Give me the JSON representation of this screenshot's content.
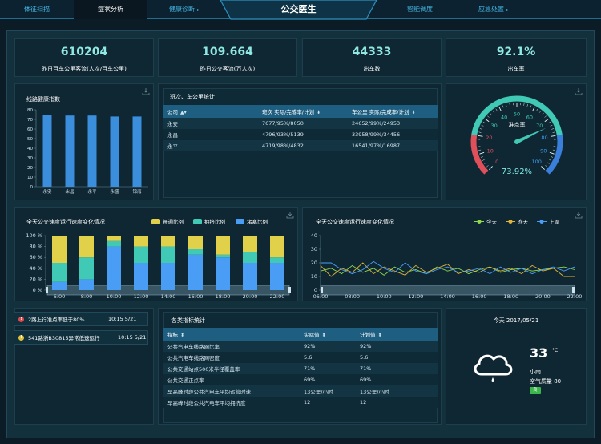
{
  "header": {
    "title": "公交医生",
    "tabs": [
      {
        "label": "体征扫描",
        "caret": ""
      },
      {
        "label": "症状分析",
        "caret": ""
      },
      {
        "label": "健康诊断",
        "caret": "▸"
      },
      {
        "label": "智能调度",
        "caret": ""
      },
      {
        "label": "应急处置",
        "caret": "▸"
      }
    ]
  },
  "stats": [
    {
      "value": "610204",
      "label": "昨日百车公里客流(人次/百车公里)"
    },
    {
      "value": "109.664",
      "label": "昨日公交客流(万人次)"
    },
    {
      "value": "44333",
      "label": "出车数"
    },
    {
      "value": "92.1%",
      "label": "出车率"
    }
  ],
  "health_chart": {
    "title": "线路健康指数",
    "chart_data": {
      "type": "bar",
      "categories": [
        "永安",
        "永昌",
        "永平",
        "永盛",
        "锦海"
      ],
      "values": [
        75,
        74,
        74,
        73,
        73
      ],
      "ylim": [
        0,
        80
      ],
      "yticks": [
        "0",
        "10",
        "20",
        "30",
        "40",
        "50",
        "60",
        "70",
        "80"
      ],
      "color": "#3a8edb"
    }
  },
  "shift_table": {
    "title": "班次、车公里统计",
    "headers": [
      "公司",
      "班次 实际/完成率/计划",
      "车公里 实际/完成率/计划"
    ],
    "rows": [
      [
        "永安",
        "7677/95%/8050",
        "24652/99%/24953"
      ],
      [
        "永昌",
        "4796/93%/5139",
        "33958/99%/34456"
      ],
      [
        "永平",
        "4719/98%/4832",
        "16541/97%/16987"
      ]
    ]
  },
  "gauge": {
    "label": "准点率",
    "value": "73.92%",
    "value_num": 73.92,
    "ticks": [
      "0",
      "10",
      "20",
      "30",
      "40",
      "50",
      "60",
      "70",
      "80",
      "90",
      "100"
    ]
  },
  "stacked_chart": {
    "title": "全天公交速度运行速度变化情况",
    "chart_data": {
      "type": "bar",
      "categories": [
        "6:00",
        "8:00",
        "10:00",
        "12:00",
        "14:00",
        "16:00",
        "18:00",
        "20:00",
        "22:00"
      ],
      "series": [
        {
          "name": "堵塞比例",
          "color": "#4a9df5",
          "values": [
            15,
            20,
            80,
            50,
            50,
            65,
            60,
            50,
            50
          ]
        },
        {
          "name": "拥挤比例",
          "color": "#40c9b5",
          "values": [
            35,
            40,
            10,
            30,
            30,
            10,
            5,
            20,
            10
          ]
        },
        {
          "name": "畅通比例",
          "color": "#e0d04a",
          "values": [
            50,
            40,
            10,
            20,
            20,
            25,
            35,
            30,
            40
          ]
        }
      ],
      "legend_order": [
        "畅通比例",
        "拥挤比例",
        "堵塞比例"
      ],
      "ylim": [
        0,
        100
      ],
      "yticks": [
        "0 %",
        "20 %",
        "40 %",
        "60 %",
        "80 %",
        "100 %"
      ]
    }
  },
  "line_chart": {
    "title": "全天公交速度运行速度变化情况",
    "chart_data": {
      "type": "line",
      "x": [
        "06:00",
        "08:00",
        "10:00",
        "12:00",
        "14:00",
        "16:00",
        "18:00",
        "20:00",
        "22:00"
      ],
      "series": [
        {
          "name": "今天",
          "color": "#8dd84e",
          "values": [
            14,
            16,
            12,
            18,
            13,
            16,
            11,
            17,
            13,
            15,
            12,
            17,
            14,
            16,
            12,
            15,
            17,
            13,
            15,
            16,
            14,
            15,
            16,
            17,
            15
          ]
        },
        {
          "name": "昨天",
          "color": "#e0b23a",
          "values": [
            18,
            10,
            16,
            13,
            20,
            12,
            17,
            14,
            11,
            18,
            13,
            16,
            19,
            12,
            15,
            13,
            17,
            14,
            16,
            12,
            18,
            14,
            16,
            10,
            10
          ]
        },
        {
          "name": "上周",
          "color": "#4a9df5",
          "values": [
            20,
            20,
            15,
            12,
            15,
            21,
            16,
            13,
            20,
            14,
            12,
            15,
            17,
            13,
            14,
            16,
            12,
            17,
            13,
            16,
            12,
            15,
            17,
            14,
            17
          ]
        }
      ],
      "ylim": [
        0,
        40
      ],
      "yticks": [
        "0",
        "10",
        "20",
        "30",
        "40"
      ]
    }
  },
  "alerts": [
    {
      "icon": "!",
      "color": "#e04a4a",
      "text": "2路上行准点率低于80%",
      "time": "10:15 5/21"
    },
    {
      "icon": "!",
      "color": "#e0c23a",
      "text": "541路浙B30815异常低速运行",
      "time": "10:15 5/21"
    }
  ],
  "kpi_table": {
    "title": "各类指标统计",
    "headers": [
      "指标",
      "实际值",
      "计划值"
    ],
    "rows": [
      [
        "公共汽电车线路网比率",
        "92%",
        "92%"
      ],
      [
        "公共汽电车线路网密度",
        "5.6",
        "5.6"
      ],
      [
        "公共交通站点500米半径覆盖率",
        "71%",
        "71%"
      ],
      [
        "公共交通正点率",
        "69%",
        "69%"
      ],
      [
        "早高峰时段公共汽电车平均运营时速",
        "13公里/小时",
        "13公里/小时"
      ],
      [
        "早高峰时段公共汽电车平均拥挤度",
        "12",
        "12"
      ]
    ]
  },
  "weather": {
    "date": "今天 2017/05/21",
    "temp": "33",
    "unit": "°C",
    "condition": "小雨",
    "aqi": "空气质量 80",
    "aqi_level": "良"
  }
}
